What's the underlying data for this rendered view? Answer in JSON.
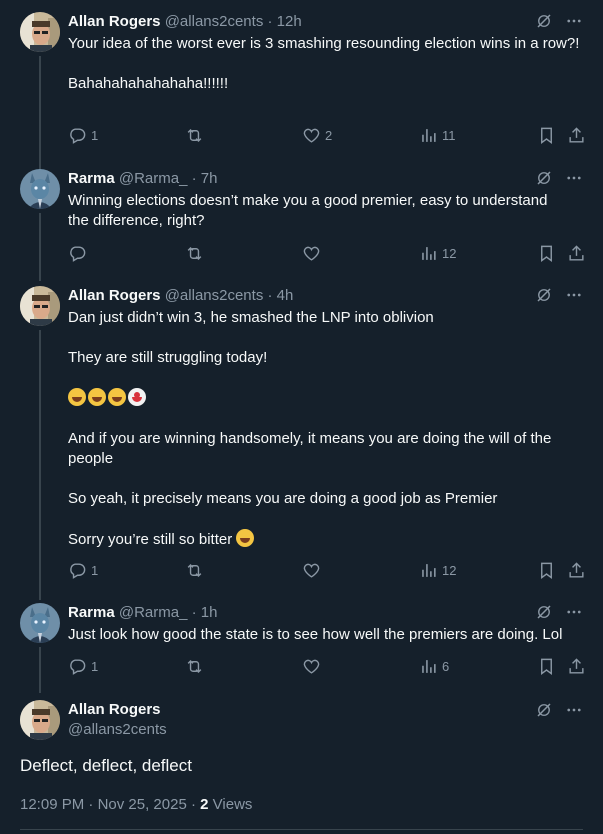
{
  "tweets": [
    {
      "name": "Allan Rogers",
      "handle": "@allans2cents",
      "sep": "·",
      "time": "12h",
      "lines": [
        "Your idea of the worst ever is 3 smashing resounding election wins in a row?!",
        "",
        "Bahahahahahahaha!!!!!!"
      ],
      "replies": "1",
      "reposts": "",
      "likes": "2",
      "views": "11"
    },
    {
      "name": "Rarma",
      "handle": "@Rarma_",
      "sep": "·",
      "time": "7h",
      "lines": [
        "Winning elections doesn’t make you a good premier, easy to understand the difference, right?"
      ],
      "replies": "",
      "reposts": "",
      "likes": "",
      "views": "12"
    },
    {
      "name": "Allan Rogers",
      "handle": "@allans2cents",
      "sep": "·",
      "time": "4h",
      "lines": [
        "Dan just didn’t win 3, he smashed the LNP into oblivion",
        "They are still struggling today!",
        "And if you are winning handsomely, it means you are doing the will of the people",
        "So yeah, it precisely means you are doing a good job as Premier",
        "Sorry you’re still so bitter"
      ],
      "replies": "1",
      "reposts": "",
      "likes": "",
      "views": "12"
    },
    {
      "name": "Rarma",
      "handle": "@Rarma_",
      "sep": "·",
      "time": "1h",
      "lines": [
        "Just look how good the state is to see how well the premiers are doing. Lol"
      ],
      "replies": "1",
      "reposts": "",
      "likes": "",
      "views": "6"
    }
  ],
  "main_tweet": {
    "name": "Allan Rogers",
    "handle": "@allans2cents",
    "text": "Deflect, deflect, deflect",
    "time": "12:09 PM",
    "sep": "·",
    "date": "Nov 25, 2025",
    "sep2": "·",
    "views_count": "2",
    "views_label": "Views"
  },
  "icons": {
    "grok": "grok-icon",
    "more": "more-icon",
    "reply": "reply-icon",
    "repost": "repost-icon",
    "like": "like-icon",
    "views": "views-icon",
    "bookmark": "bookmark-icon",
    "share": "share-icon"
  },
  "colors": {
    "background": "#15202b",
    "text": "#f7f9f9",
    "secondary": "#8b98a5",
    "line": "#38444d"
  }
}
